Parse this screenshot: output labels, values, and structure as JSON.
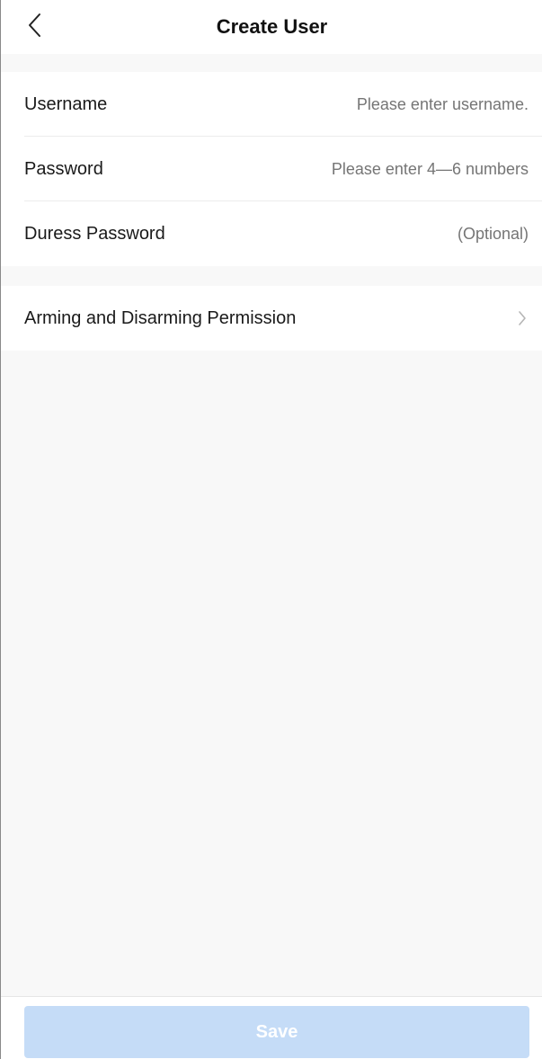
{
  "header": {
    "title": "Create User",
    "back_icon": "chevron-left-icon"
  },
  "form": {
    "username": {
      "label": "Username",
      "placeholder": "Please enter username.",
      "value": ""
    },
    "password": {
      "label": "Password",
      "placeholder": "Please enter 4—6 numbers",
      "value": ""
    },
    "duress_password": {
      "label": "Duress Password",
      "placeholder": "(Optional)",
      "value": ""
    }
  },
  "permission": {
    "label": "Arming and Disarming Permission",
    "icon": "chevron-right-icon"
  },
  "footer": {
    "save_label": "Save",
    "save_enabled": false
  },
  "colors": {
    "background": "#f8f8f8",
    "placeholder": "#a6a6a6",
    "save_disabled_bg": "#c5dcf7",
    "text": "#1a1a1a"
  }
}
